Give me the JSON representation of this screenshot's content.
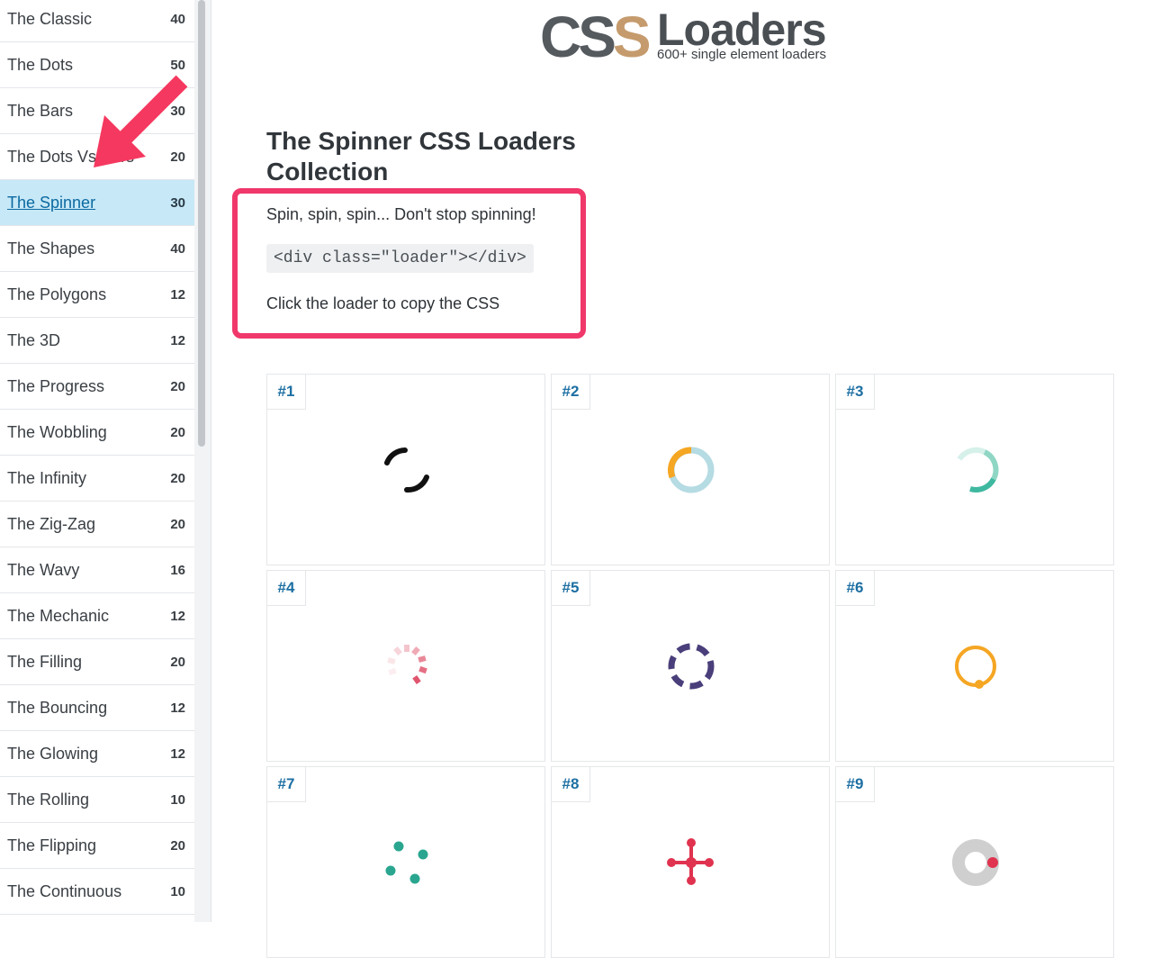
{
  "sidebar": {
    "items": [
      {
        "label": "The Classic",
        "count": "40"
      },
      {
        "label": "The Dots",
        "count": "50"
      },
      {
        "label": "The Bars",
        "count": "30"
      },
      {
        "label": "The Dots Vs Bars",
        "count": "20"
      },
      {
        "label": "The Spinner",
        "count": "30",
        "active": true
      },
      {
        "label": "The Shapes",
        "count": "40"
      },
      {
        "label": "The Polygons",
        "count": "12"
      },
      {
        "label": "The 3D",
        "count": "12"
      },
      {
        "label": "The Progress",
        "count": "20"
      },
      {
        "label": "The Wobbling",
        "count": "20"
      },
      {
        "label": "The Infinity",
        "count": "20"
      },
      {
        "label": "The Zig-Zag",
        "count": "20"
      },
      {
        "label": "The Wavy",
        "count": "16"
      },
      {
        "label": "The Mechanic",
        "count": "12"
      },
      {
        "label": "The Filling",
        "count": "20"
      },
      {
        "label": "The Bouncing",
        "count": "12"
      },
      {
        "label": "The Glowing",
        "count": "12"
      },
      {
        "label": "The Rolling",
        "count": "10"
      },
      {
        "label": "The Flipping",
        "count": "20"
      },
      {
        "label": "The Continuous",
        "count": "10"
      }
    ]
  },
  "header": {
    "logo_css_a": "CS",
    "logo_css_b": "S",
    "logo_word": "Loaders",
    "logo_sub": "600+ single element loaders"
  },
  "main": {
    "title": "The Spinner CSS Loaders Collection",
    "tagline": "Spin, spin, spin... Don't stop spinning!",
    "code": "<div class=\"loader\"></div>",
    "hint": "Click the loader to copy the CSS"
  },
  "cards": [
    {
      "label": "#1",
      "icon": "spinner-arc-icon"
    },
    {
      "label": "#2",
      "icon": "ring-spinner-icon"
    },
    {
      "label": "#3",
      "icon": "gradient-ring-icon"
    },
    {
      "label": "#4",
      "icon": "dashed-fade-spinner-icon"
    },
    {
      "label": "#5",
      "icon": "segmented-ring-icon"
    },
    {
      "label": "#6",
      "icon": "orbit-ring-icon"
    },
    {
      "label": "#7",
      "icon": "four-dots-icon"
    },
    {
      "label": "#8",
      "icon": "molecule-icon"
    },
    {
      "label": "#9",
      "icon": "donut-dot-icon"
    }
  ],
  "colors": {
    "accent": "#f0386b",
    "active_bg": "#c7e8f7",
    "link": "#0b6aa1",
    "card_number": "#1d6fa3"
  }
}
